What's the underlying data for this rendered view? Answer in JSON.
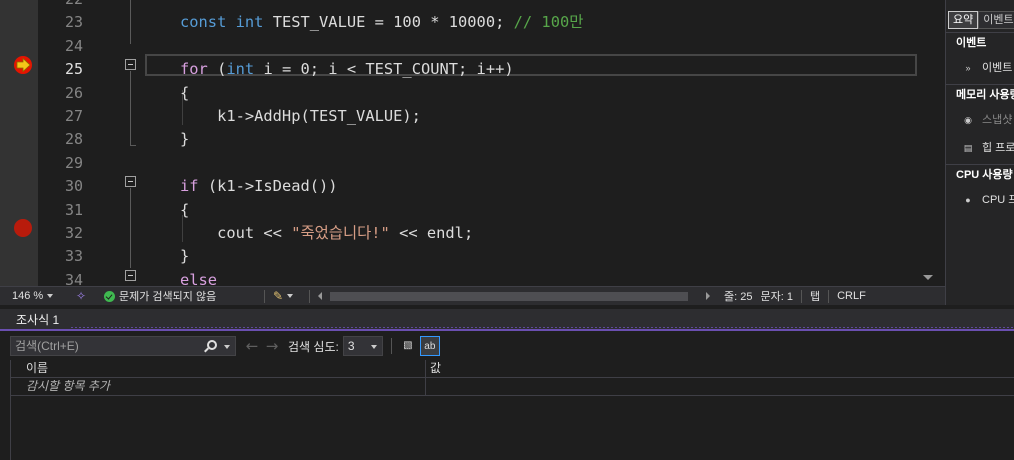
{
  "editor": {
    "lines": [
      {
        "num": "22",
        "parts": []
      },
      {
        "num": "23",
        "parts": [
          {
            "t": "const",
            "c": "kw"
          },
          {
            "t": " ",
            "c": "txt"
          },
          {
            "t": "int",
            "c": "kw"
          },
          {
            "t": " TEST_VALUE = 100 * 10000; ",
            "c": "txt"
          },
          {
            "t": "// 100만",
            "c": "cmt"
          }
        ]
      },
      {
        "num": "24",
        "parts": []
      },
      {
        "num": "25",
        "parts": [
          {
            "t": "for",
            "c": "kw2"
          },
          {
            "t": " (",
            "c": "txt"
          },
          {
            "t": "int",
            "c": "kw"
          },
          {
            "t": " i = 0; i < TEST_COUNT; i++)",
            "c": "txt"
          }
        ]
      },
      {
        "num": "26",
        "parts": [
          {
            "t": "{",
            "c": "txt"
          }
        ]
      },
      {
        "num": "27",
        "parts": [
          {
            "t": "    k1->AddHp(TEST_VALUE);",
            "c": "txt"
          }
        ]
      },
      {
        "num": "28",
        "parts": [
          {
            "t": "}",
            "c": "txt"
          }
        ]
      },
      {
        "num": "29",
        "parts": []
      },
      {
        "num": "30",
        "parts": [
          {
            "t": "if",
            "c": "kw2"
          },
          {
            "t": " (k1->IsDead())",
            "c": "txt"
          }
        ]
      },
      {
        "num": "31",
        "parts": [
          {
            "t": "{",
            "c": "txt"
          }
        ]
      },
      {
        "num": "32",
        "parts": [
          {
            "t": "    cout << ",
            "c": "txt"
          },
          {
            "t": "\"죽었습니다!\"",
            "c": "str"
          },
          {
            "t": " << endl;",
            "c": "txt"
          }
        ]
      },
      {
        "num": "33",
        "parts": [
          {
            "t": "}",
            "c": "txt"
          }
        ]
      },
      {
        "num": "34",
        "parts": [
          {
            "t": "else",
            "c": "kw2"
          }
        ]
      }
    ],
    "current_line": "25",
    "breakpoint_line": "32"
  },
  "status": {
    "zoom": "146 %",
    "issues": "문제가 검색되지 않음",
    "line": "줄: 25",
    "column": "문자: 1",
    "indent": "탭",
    "line_ending": "CRLF"
  },
  "diagnostics": {
    "tabs": [
      "요약",
      "이벤트"
    ],
    "events_header": "이벤트",
    "events_item": "이벤트",
    "memory_header": "메모리 사용량",
    "snapshot_item": "스냅샷",
    "heap_item": "힙 프로파일링",
    "cpu_header": "CPU 사용량",
    "cpu_item": "CPU 프로파일링"
  },
  "watch": {
    "title": "조사식 1",
    "search_placeholder": "검색(Ctrl+E)",
    "search_depth_label": "검색 심도:",
    "search_depth_value": "3",
    "col_name": "이름",
    "col_value": "값",
    "add_item": "감시할 항목 추가"
  }
}
